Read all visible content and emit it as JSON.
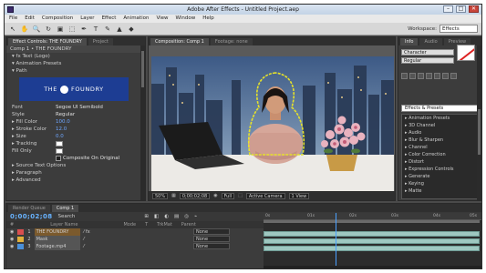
{
  "window": {
    "title": "Adobe After Effects - Untitled Project.aep",
    "controls": [
      "–",
      "□",
      "✕"
    ]
  },
  "menu": [
    "File",
    "Edit",
    "Composition",
    "Layer",
    "Effect",
    "Animation",
    "View",
    "Window",
    "Help"
  ],
  "toolbar": {
    "tools": [
      "↖",
      "✋",
      "🔍",
      "↻",
      "▣",
      "⬚",
      "✒",
      "T",
      "✎",
      "▲",
      "◆"
    ],
    "workspace_label": "Workspace:",
    "workspace_value": "Effects"
  },
  "effects_panel": {
    "tabs": [
      "Effect Controls: THE FOUNDRY",
      "Project"
    ],
    "subheader": "Comp 1 • THE FOUNDRY",
    "rows": [
      {
        "label": "▾ fx  Text (Logo)"
      },
      {
        "label": "   ▾ Animation Presets"
      },
      {
        "label": "   ▾ Path"
      }
    ],
    "preview_left": "THE",
    "preview_right": "FOUNDRY",
    "params": [
      {
        "label": "   Font",
        "value": "Segoe UI Semibold"
      },
      {
        "label": "   Style",
        "value": "Regular"
      },
      {
        "label": "   ▸ Fill Color",
        "value": "100.0"
      },
      {
        "label": "   ▸ Stroke Color",
        "value": "12.0"
      },
      {
        "label": "   ▸ Size",
        "value": "0.0"
      },
      {
        "label": "   ▸ Tracking",
        "value": ""
      },
      {
        "label": "   Fill Only",
        "value": ""
      }
    ],
    "checkbox_label": "Composite On Original",
    "footer_rows": [
      "▸ Source Text Options",
      "▸ Paragraph",
      "▸ Advanced"
    ]
  },
  "comp_panel": {
    "tabs": [
      "Composition: Comp 1",
      "Footage: none"
    ],
    "footer": {
      "zoom": "50%",
      "timecode": "0;00;02;08",
      "resolution": "Full",
      "camera": "Active Camera",
      "view": "1 View"
    }
  },
  "right_panel": {
    "tabs": [
      "Info",
      "Audio",
      "Preview"
    ],
    "dropdown_1": "Character",
    "dropdown_2": "Regular",
    "search_placeholder": "Effects & Presets",
    "list": [
      "▸ Animation Presets",
      "▸ 3D Channel",
      "▸ Audio",
      "▸ Blur & Sharpen",
      "▸ Channel",
      "▸ Color Correction",
      "▸ Distort",
      "▸ Expression Controls",
      "▸ Generate",
      "▸ Keying",
      "▸ Matte"
    ]
  },
  "timeline": {
    "tabs": [
      "Render Queue",
      "Comp 1"
    ],
    "timecode": "0;00;02;08",
    "search_placeholder": "Search",
    "columns": [
      "#",
      "Layer Name",
      "Mode",
      "T",
      "TrkMat",
      "Parent"
    ],
    "layers": [
      {
        "num": "1",
        "name": "THE FOUNDRY",
        "parent": "None",
        "label_color": "#d94f4f",
        "selected": true
      },
      {
        "num": "2",
        "name": "Mask",
        "parent": "None",
        "label_color": "#e0b03a",
        "selected": false
      },
      {
        "num": "3",
        "name": "Footage.mp4",
        "parent": "None",
        "label_color": "#4a90d9",
        "selected": false
      }
    ],
    "ruler": [
      "0s",
      "01s",
      "02s",
      "03s",
      "04s",
      "05s"
    ],
    "playhead_fraction": 0.33
  },
  "colors": {
    "panel_bg": "#3c3c3c",
    "accent_blue": "#68b3ff",
    "mask_yellow": "#e6e22a",
    "layer_bar": "#9ec7c0"
  }
}
